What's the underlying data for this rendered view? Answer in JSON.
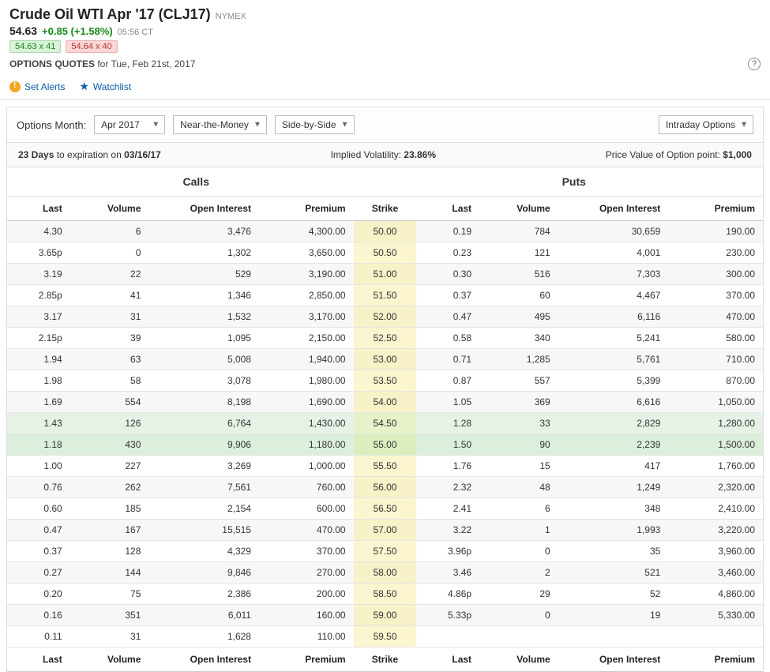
{
  "header": {
    "title": "Crude Oil WTI Apr '17 (CLJ17)",
    "exchange": "NYMEX",
    "price": "54.63",
    "change": "+0.85 (+1.58%)",
    "time": "05:56 CT",
    "bid": "54.63 x 41",
    "ask": "54.64 x 40",
    "subtitle_strong": "OPTIONS QUOTES",
    "subtitle_rest": " for Tue, Feb 21st, 2017"
  },
  "actions": {
    "alerts": "Set Alerts",
    "watchlist": "Watchlist"
  },
  "controls": {
    "label": "Options Month:",
    "month": "Apr 2017",
    "filter": "Near-the-Money",
    "layout": "Side-by-Side",
    "view": "Intraday Options"
  },
  "info": {
    "days_num": "23 Days",
    "days_rest": " to expiration on ",
    "exp_date": "03/16/17",
    "iv_label": "Implied Volatility: ",
    "iv_value": "23.86%",
    "pv_label": "Price Value of Option point: ",
    "pv_value": "$1,000"
  },
  "groups": {
    "calls": "Calls",
    "puts": "Puts"
  },
  "columns": {
    "last": "Last",
    "volume": "Volume",
    "oi": "Open Interest",
    "premium": "Premium",
    "strike": "Strike"
  },
  "rows": [
    {
      "c_last": "4.30",
      "c_vol": "6",
      "c_oi": "3,476",
      "c_prem": "4,300.00",
      "strike": "50.00",
      "p_last": "0.19",
      "p_vol": "784",
      "p_oi": "30,659",
      "p_prem": "190.00",
      "cls": "alt"
    },
    {
      "c_last": "3.65p",
      "c_vol": "0",
      "c_oi": "1,302",
      "c_prem": "3,650.00",
      "strike": "50.50",
      "p_last": "0.23",
      "p_vol": "121",
      "p_oi": "4,001",
      "p_prem": "230.00",
      "cls": ""
    },
    {
      "c_last": "3.19",
      "c_vol": "22",
      "c_oi": "529",
      "c_prem": "3,190.00",
      "strike": "51.00",
      "p_last": "0.30",
      "p_vol": "516",
      "p_oi": "7,303",
      "p_prem": "300.00",
      "cls": "alt"
    },
    {
      "c_last": "2.85p",
      "c_vol": "41",
      "c_oi": "1,346",
      "c_prem": "2,850.00",
      "strike": "51.50",
      "p_last": "0.37",
      "p_vol": "60",
      "p_oi": "4,467",
      "p_prem": "370.00",
      "cls": ""
    },
    {
      "c_last": "3.17",
      "c_vol": "31",
      "c_oi": "1,532",
      "c_prem": "3,170.00",
      "strike": "52.00",
      "p_last": "0.47",
      "p_vol": "495",
      "p_oi": "6,116",
      "p_prem": "470.00",
      "cls": "alt"
    },
    {
      "c_last": "2.15p",
      "c_vol": "39",
      "c_oi": "1,095",
      "c_prem": "2,150.00",
      "strike": "52.50",
      "p_last": "0.58",
      "p_vol": "340",
      "p_oi": "5,241",
      "p_prem": "580.00",
      "cls": ""
    },
    {
      "c_last": "1.94",
      "c_vol": "63",
      "c_oi": "5,008",
      "c_prem": "1,940.00",
      "strike": "53.00",
      "p_last": "0.71",
      "p_vol": "1,285",
      "p_oi": "5,761",
      "p_prem": "710.00",
      "cls": "alt"
    },
    {
      "c_last": "1.98",
      "c_vol": "58",
      "c_oi": "3,078",
      "c_prem": "1,980.00",
      "strike": "53.50",
      "p_last": "0.87",
      "p_vol": "557",
      "p_oi": "5,399",
      "p_prem": "870.00",
      "cls": ""
    },
    {
      "c_last": "1.69",
      "c_vol": "554",
      "c_oi": "8,198",
      "c_prem": "1,690.00",
      "strike": "54.00",
      "p_last": "1.05",
      "p_vol": "369",
      "p_oi": "6,616",
      "p_prem": "1,050.00",
      "cls": "alt"
    },
    {
      "c_last": "1.43",
      "c_vol": "126",
      "c_oi": "6,764",
      "c_prem": "1,430.00",
      "strike": "54.50",
      "p_last": "1.28",
      "p_vol": "33",
      "p_oi": "2,829",
      "p_prem": "1,280.00",
      "cls": "hl1"
    },
    {
      "c_last": "1.18",
      "c_vol": "430",
      "c_oi": "9,906",
      "c_prem": "1,180.00",
      "strike": "55.00",
      "p_last": "1.50",
      "p_vol": "90",
      "p_oi": "2,239",
      "p_prem": "1,500.00",
      "cls": "hl2"
    },
    {
      "c_last": "1.00",
      "c_vol": "227",
      "c_oi": "3,269",
      "c_prem": "1,000.00",
      "strike": "55.50",
      "p_last": "1.76",
      "p_vol": "15",
      "p_oi": "417",
      "p_prem": "1,760.00",
      "cls": ""
    },
    {
      "c_last": "0.76",
      "c_vol": "262",
      "c_oi": "7,561",
      "c_prem": "760.00",
      "strike": "56.00",
      "p_last": "2.32",
      "p_vol": "48",
      "p_oi": "1,249",
      "p_prem": "2,320.00",
      "cls": "alt"
    },
    {
      "c_last": "0.60",
      "c_vol": "185",
      "c_oi": "2,154",
      "c_prem": "600.00",
      "strike": "56.50",
      "p_last": "2.41",
      "p_vol": "6",
      "p_oi": "348",
      "p_prem": "2,410.00",
      "cls": ""
    },
    {
      "c_last": "0.47",
      "c_vol": "167",
      "c_oi": "15,515",
      "c_prem": "470.00",
      "strike": "57.00",
      "p_last": "3.22",
      "p_vol": "1",
      "p_oi": "1,993",
      "p_prem": "3,220.00",
      "cls": "alt"
    },
    {
      "c_last": "0.37",
      "c_vol": "128",
      "c_oi": "4,329",
      "c_prem": "370.00",
      "strike": "57.50",
      "p_last": "3.96p",
      "p_vol": "0",
      "p_oi": "35",
      "p_prem": "3,960.00",
      "cls": ""
    },
    {
      "c_last": "0.27",
      "c_vol": "144",
      "c_oi": "9,846",
      "c_prem": "270.00",
      "strike": "58.00",
      "p_last": "3.46",
      "p_vol": "2",
      "p_oi": "521",
      "p_prem": "3,460.00",
      "cls": "alt"
    },
    {
      "c_last": "0.20",
      "c_vol": "75",
      "c_oi": "2,386",
      "c_prem": "200.00",
      "strike": "58.50",
      "p_last": "4.86p",
      "p_vol": "29",
      "p_oi": "52",
      "p_prem": "4,860.00",
      "cls": ""
    },
    {
      "c_last": "0.16",
      "c_vol": "351",
      "c_oi": "6,011",
      "c_prem": "160.00",
      "strike": "59.00",
      "p_last": "5.33p",
      "p_vol": "0",
      "p_oi": "19",
      "p_prem": "5,330.00",
      "cls": "alt"
    },
    {
      "c_last": "0.11",
      "c_vol": "31",
      "c_oi": "1,628",
      "c_prem": "110.00",
      "strike": "59.50",
      "p_last": "",
      "p_vol": "",
      "p_oi": "",
      "p_prem": "",
      "cls": ""
    }
  ]
}
